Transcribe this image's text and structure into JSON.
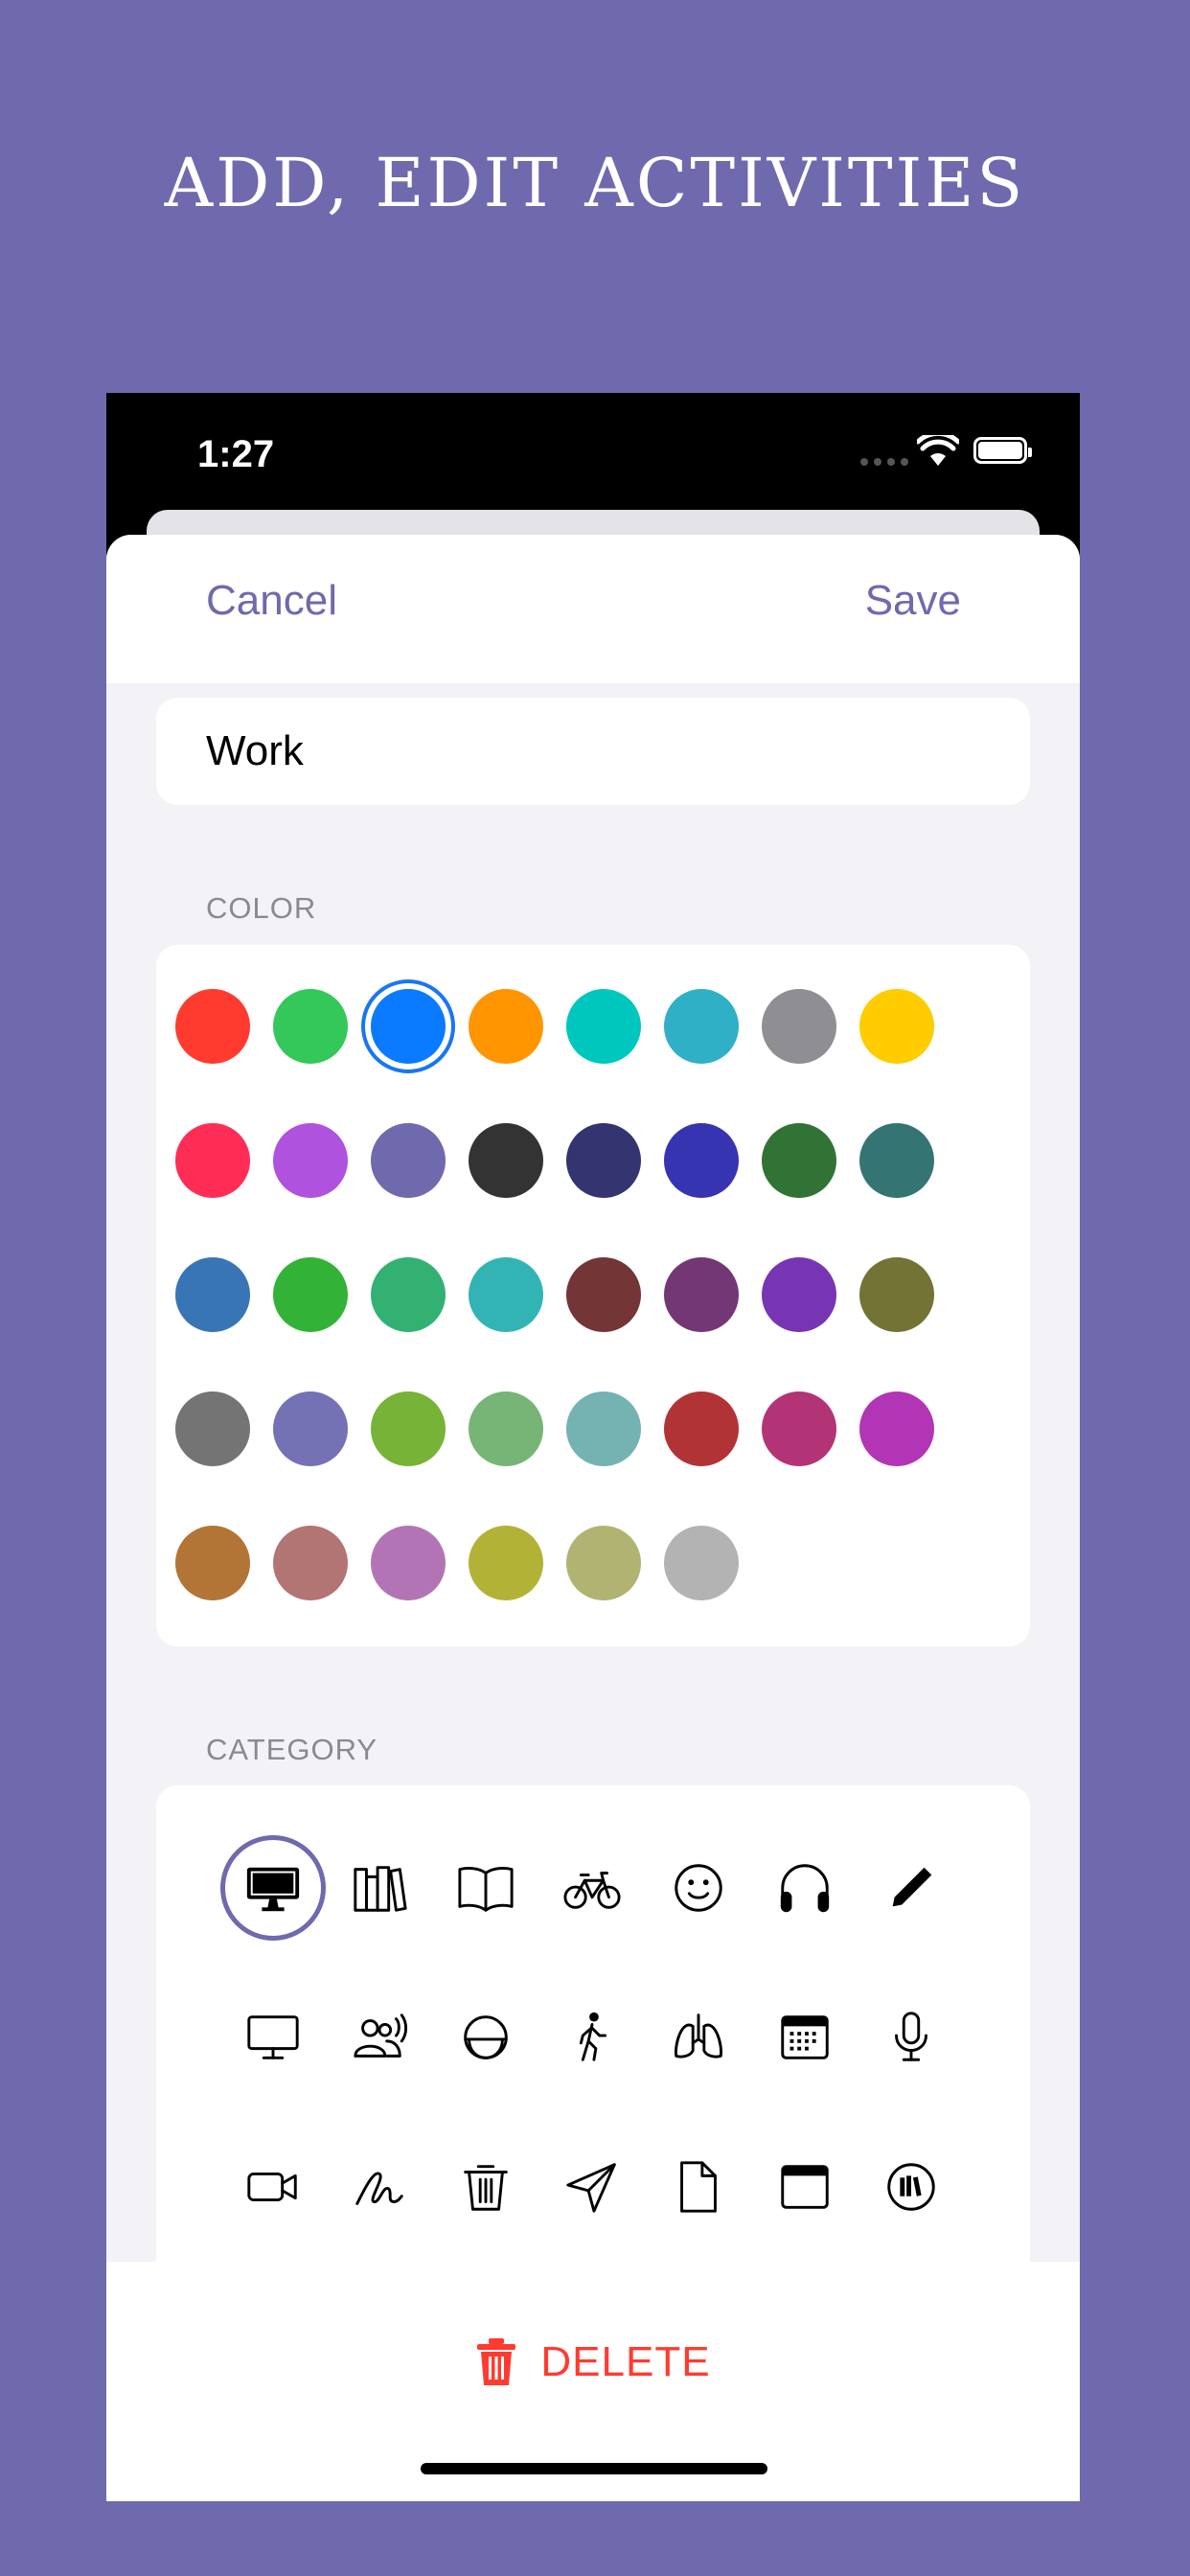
{
  "headline": "ADD, EDIT ACTIVITIES",
  "status_bar": {
    "time": "1:27"
  },
  "nav": {
    "cancel_label": "Cancel",
    "save_label": "Save"
  },
  "activity_name": "Work",
  "sections": {
    "color": "COLOR",
    "category": "CATEGORY"
  },
  "colors": {
    "selected_index": 2,
    "swatches": [
      "#ff3b30",
      "#34c759",
      "#0a7aff",
      "#ff9500",
      "#00c7be",
      "#30b0c7",
      "#8e8e93",
      "#ffcc00",
      "#ff2d55",
      "#af52de",
      "#6f69ae",
      "#333333",
      "#333470",
      "#3634b0",
      "#317335",
      "#347573",
      "#3875b5",
      "#33b238",
      "#33b172",
      "#33b4b4",
      "#733535",
      "#733775",
      "#7735b3",
      "#737335",
      "#747474",
      "#7571b5",
      "#76b336",
      "#76b575",
      "#75b2b2",
      "#b23335",
      "#b23476",
      "#b235b5",
      "#b27536",
      "#b27574",
      "#b374b5",
      "#b2b336",
      "#b1b373",
      "#b3b3b3"
    ]
  },
  "categories": {
    "selected_index": 0,
    "icons": [
      "desktop-computer-icon",
      "books-icon",
      "book-icon",
      "bicycle-icon",
      "smiley-face-icon",
      "headphones-icon",
      "pencil-icon",
      "display-icon",
      "people-talking-icon",
      "moon-icon",
      "walking-figure-icon",
      "lungs-icon",
      "calendar-icon",
      "microphone-icon",
      "video-camera-icon",
      "signature-icon",
      "trash-icon",
      "paper-plane-icon",
      "document-icon",
      "window-icon",
      "library-icon"
    ]
  },
  "footer": {
    "delete_label": "DELETE"
  }
}
